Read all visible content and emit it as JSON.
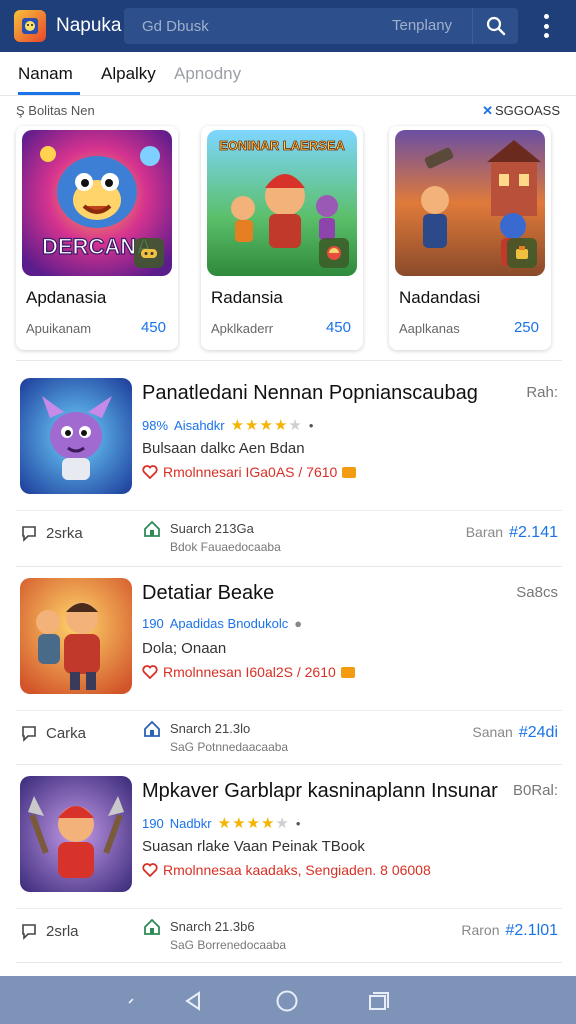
{
  "app": {
    "title": "Napuka",
    "logo_icon": "app-logo-icon"
  },
  "search": {
    "placeholder": "Gd Dbusk",
    "filter_label": "Tenplany",
    "search_icon": "search-icon"
  },
  "tabs": [
    {
      "label": "Nanam",
      "active": true
    },
    {
      "label": "Alpalky",
      "active": false
    },
    {
      "label": "Apnodny",
      "active": false
    }
  ],
  "section": {
    "title": "Ş Bolitas Nen",
    "more_label": "SGGOASS",
    "more_prefix": "✕"
  },
  "featured": [
    {
      "art_text": "DERCANA",
      "name": "Apdanasia",
      "sub": "Apuikanam",
      "num": "450"
    },
    {
      "art_text": "EONINAR LAERSEA",
      "name": "Radansia",
      "sub": "Apklkaderr",
      "num": "450"
    },
    {
      "art_text": "",
      "name": "Nadandasi",
      "sub": "Aaplkanas",
      "num": "250"
    }
  ],
  "rows": [
    {
      "title": "Panatledani Nennan Popnianscaubag",
      "title_extra": "Rah:",
      "meta_prefix": "98%",
      "meta_text": "Aisahdkr",
      "stars": 4,
      "meta_suffix": "•",
      "desc": "Bulsaan dalkc  Aen Bdan",
      "reward": "Rmolnnesari IGa0AS / 7610",
      "comment": "2srka",
      "install_line1": "Suarch 213Ga",
      "install_line2": "Bdok Fauaedocaaba",
      "price_label": "Baran",
      "price_value": "#2.141"
    },
    {
      "title": "Detatiar Beake",
      "title_extra": "Sa8cs",
      "meta_prefix": "190",
      "meta_text": "Apadidas Bnodukolc",
      "stars": 0,
      "meta_suffix": "●",
      "desc": "Dola; Onaan",
      "reward": "Rmolnnesan I60al2S / 2610",
      "comment": "Carka",
      "install_line1": "Snarch 21.3lo",
      "install_line2": "SaG Potnnedaacaaba",
      "price_label": "Sanan",
      "price_value": "#24di"
    },
    {
      "title": "Mpkaver Garblapr kasninaplann Insunar",
      "title_extra": "B0Ral:",
      "meta_prefix": "190",
      "meta_text": "Nadbkr",
      "stars": 4,
      "meta_suffix": "•",
      "desc": "Suasan rlake  Vaan Peinak TBook",
      "reward": "Rmolnnesaa kaadaks, Sengiaden. 8 06008",
      "comment": "2srla",
      "install_line1": "Snarch 21.3b6",
      "install_line2": "SaG Borrenedocaaba",
      "price_label": "Raron",
      "price_value": "#2.1l01"
    }
  ],
  "navbar": {
    "icons": [
      "chevron-icon",
      "back-icon",
      "home-icon",
      "recents-icon"
    ]
  },
  "colors": {
    "header": "#1f3f7a",
    "accent": "#1a73e8",
    "reward": "#d93025",
    "star": "#f4b400",
    "navbar": "#7d93b8"
  }
}
